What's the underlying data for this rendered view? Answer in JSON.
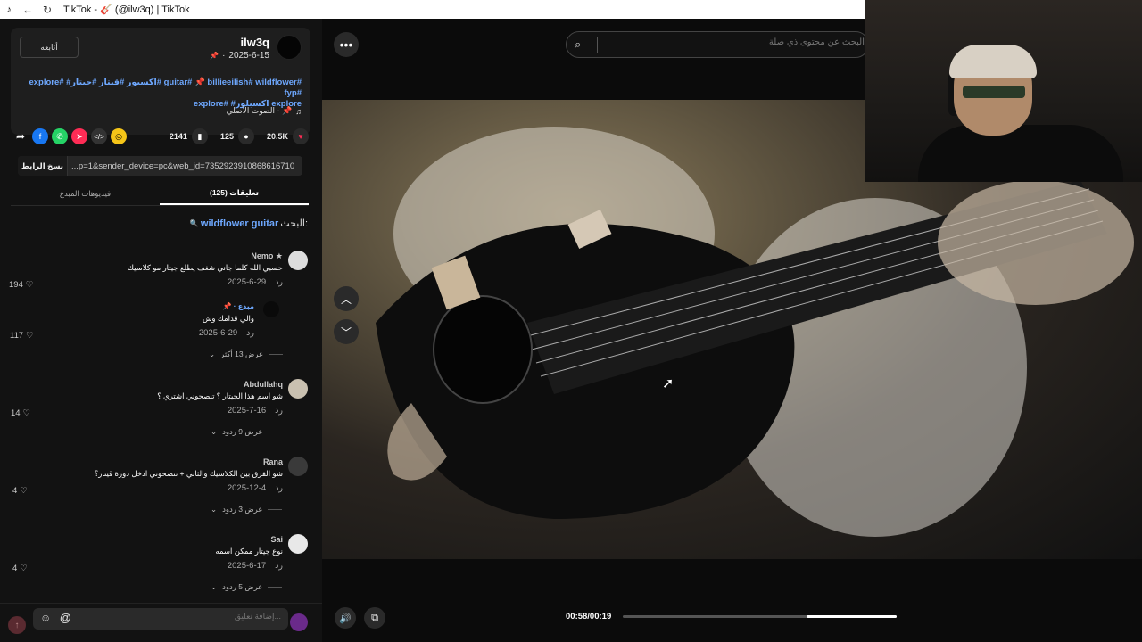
{
  "window": {
    "title": "TikTok - 🎸 (@ilw3q) | TikTok"
  },
  "post": {
    "follow_label": "أتابعه",
    "username": "ilw3q",
    "date": "2025-6-15",
    "date_separator": "·",
    "tags_line1": "explore# #اكسبور #قيتار #جيتار# guitar# 📌 billieeilish# wildflower# fyp#",
    "tags_line2": "explore# #اكسبلور explore",
    "music_label": "الصوت الأصلي - 📌",
    "music_icon": "♫"
  },
  "actions": {
    "likes": "20.5K",
    "comments": "125",
    "bookmarks": "2141"
  },
  "link": {
    "copy_label": "نسخ الرابط",
    "url": "...p=1&sender_device=pc&web_id=7352923910868616710"
  },
  "tabs": {
    "comments": "(125) تعليقات",
    "creator_videos": "فيديوهات المبدع"
  },
  "search_line": {
    "prefix": "البحث:",
    "query": "wildflower guitar",
    "icon": "🔍"
  },
  "comments": [
    {
      "name": "Nemo ★",
      "text": "حسبي الله كلما جاني شغف يطلع جيتار مو كلاسيك",
      "date": "2025-6-29",
      "reply": "رد",
      "likes": "194"
    },
    {
      "name": "📌 · مبدع",
      "text": "والي قدامك وش",
      "date": "2025-6-29",
      "reply": "رد",
      "likes": "117"
    },
    {
      "name": "Abdullahq",
      "text": "شو اسم هذا الجيتار ؟ تنصحوني اشتري ؟",
      "date": "2025-7-16",
      "reply": "رد",
      "likes": "14"
    },
    {
      "name": "Rana",
      "text": "شو الفرق بين الكلاسيك والثاني + تنصحوني ادخل دورة قيتار؟",
      "date": "2025-12-4",
      "reply": "رد",
      "likes": "4"
    },
    {
      "name": "Sai",
      "text": "نوع جيتار ممكن اسمه",
      "date": "2025-6-17",
      "reply": "رد",
      "likes": "4"
    }
  ],
  "view_more": {
    "c2": "عرض 13 أكثر",
    "c3": "عرض 9 ردود",
    "c4": "عرض 3 ردود",
    "c5": "عرض 5 ردود"
  },
  "comment_input": {
    "placeholder": "إضافة تعليق..."
  },
  "video": {
    "search_placeholder": "البحث عن محتوى ذي صلة",
    "time": "00:58/00:19",
    "progress": 0.33
  },
  "icons": {
    "more": "more-horizontal-icon",
    "up": "chevron-up-icon",
    "down": "chevron-down-icon",
    "volume": "volume-icon",
    "pip": "picture-in-picture-icon"
  },
  "colors": {
    "accent": "#fe2c55",
    "link": "#6ea8ff"
  }
}
